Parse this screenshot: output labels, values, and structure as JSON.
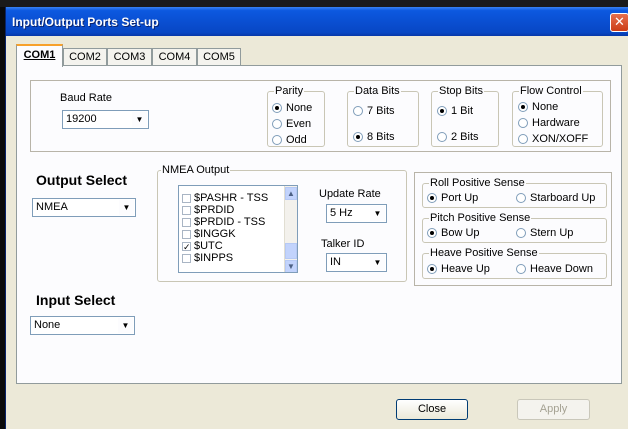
{
  "window": {
    "title": "Input/Output Ports Set-up",
    "close_glyph": "✕"
  },
  "tabs": [
    {
      "label": "COM1",
      "active": true
    },
    {
      "label": "COM2",
      "active": false
    },
    {
      "label": "COM3",
      "active": false
    },
    {
      "label": "COM4",
      "active": false
    },
    {
      "label": "COM5",
      "active": false
    }
  ],
  "baud_rate": {
    "label": "Baud Rate",
    "value": "19200"
  },
  "parity": {
    "label": "Parity",
    "options": [
      "None",
      "Even",
      "Odd"
    ],
    "selected": "None"
  },
  "data_bits": {
    "label": "Data Bits",
    "options": [
      "7 Bits",
      "8 Bits"
    ],
    "selected": "8 Bits"
  },
  "stop_bits": {
    "label": "Stop Bits",
    "options": [
      "1 Bit",
      "2 Bits"
    ],
    "selected": "1 Bit"
  },
  "flow_control": {
    "label": "Flow Control",
    "options": [
      "None",
      "Hardware",
      "XON/XOFF"
    ],
    "selected": "None"
  },
  "output_select": {
    "label": "Output Select",
    "value": "NMEA"
  },
  "nmea_output": {
    "label": "NMEA Output",
    "items": [
      {
        "label": "$PASHR - TSS",
        "checked": false
      },
      {
        "label": "$PRDID",
        "checked": false
      },
      {
        "label": "$PRDID - TSS",
        "checked": false
      },
      {
        "label": "$INGGK",
        "checked": false
      },
      {
        "label": "$UTC",
        "checked": true
      },
      {
        "label": "$INPPS",
        "checked": false
      }
    ]
  },
  "update_rate": {
    "label": "Update Rate",
    "value": "5 Hz"
  },
  "talker_id": {
    "label": "Talker ID",
    "value": "IN"
  },
  "roll_sense": {
    "label": "Roll Positive Sense",
    "options": [
      "Port Up",
      "Starboard Up"
    ],
    "selected": "Port Up"
  },
  "pitch_sense": {
    "label": "Pitch Positive Sense",
    "options": [
      "Bow Up",
      "Stern Up"
    ],
    "selected": "Bow Up"
  },
  "heave_sense": {
    "label": "Heave Positive Sense",
    "options": [
      "Heave Up",
      "Heave Down"
    ],
    "selected": "Heave Up"
  },
  "input_select": {
    "label": "Input Select",
    "value": "None"
  },
  "buttons": {
    "close": "Close",
    "apply": "Apply"
  },
  "icons": {
    "dropdown": "▼",
    "scroll_up": "▲",
    "scroll_down": "▼",
    "check": "✓"
  }
}
